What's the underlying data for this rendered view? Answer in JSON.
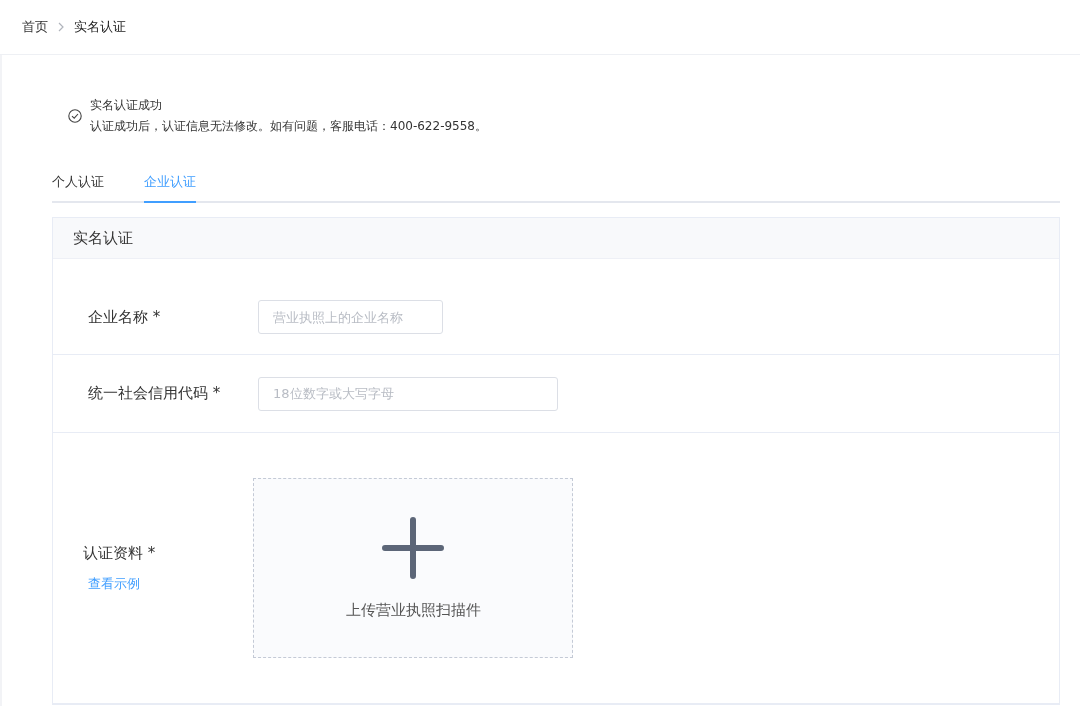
{
  "breadcrumb": [
    {
      "label": "首页",
      "selected": false
    },
    {
      "label": "实名认证",
      "selected": true
    }
  ],
  "notice": {
    "title": "实名认证成功",
    "message": "认证成功后，认证信息无法修改。如有问题，客服电话：400-622-9558。"
  },
  "tabs": [
    {
      "label": "个人认证",
      "selected": false
    },
    {
      "label": "企业认证",
      "selected": true
    }
  ],
  "card": {
    "title": "实名认证",
    "rows": [
      {
        "kind": "input",
        "label": "企业名称 *",
        "placeholder": "营业执照上的企业名称",
        "wide": false
      },
      {
        "kind": "input",
        "label": "统一社会信用代码 *",
        "placeholder": "18位数字或大写字母",
        "wide": true
      },
      {
        "kind": "upload",
        "label": "认证资料 *",
        "link": "查看示例",
        "upload_text": "上传营业执照扫描件"
      }
    ]
  }
}
